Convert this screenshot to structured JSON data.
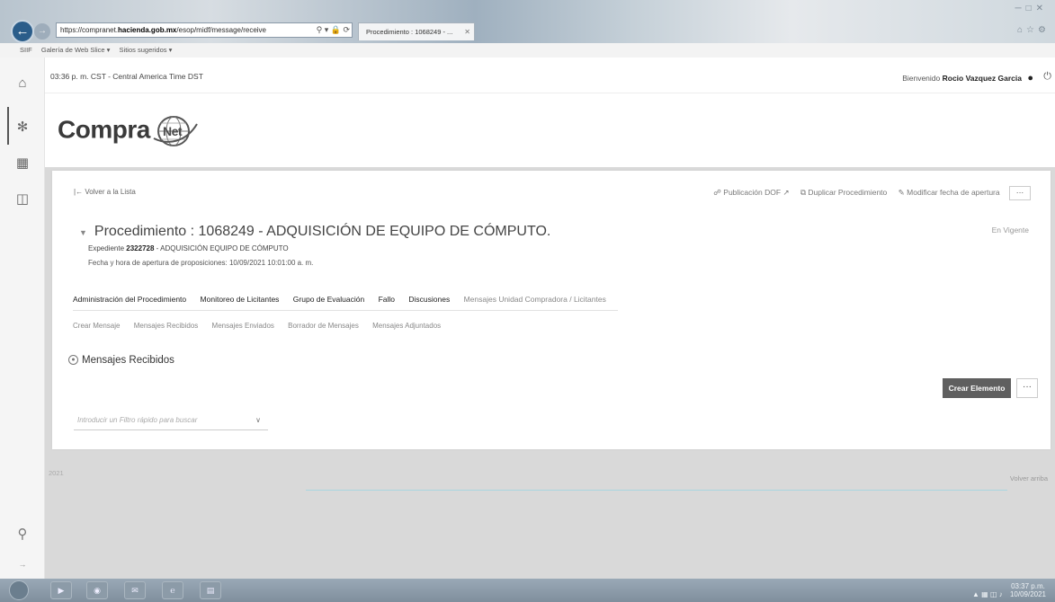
{
  "browser": {
    "url_prefix": "https://compranet.",
    "url_domain": "hacienda.gob.mx",
    "url_rest": "/esop/midf/message/receive",
    "tab_title": "Procedimiento : 1068249 - ...",
    "favorites": [
      "SIIF",
      "Galería de Web Slice ▾",
      "Sitios sugeridos ▾"
    ]
  },
  "header": {
    "time": "03:36 p. m. CST - Central America Time DST",
    "welcome_label": "Bienvenido",
    "user_name": "Rocio Vazquez Garcia"
  },
  "logo": {
    "text": "Compra",
    "text_globe": "Net"
  },
  "page": {
    "back_link": "Volver a la Lista",
    "actions": [
      "Publicación DOF",
      "Duplicar Procedimiento",
      "Modificar fecha de apertura"
    ],
    "more_label": "···",
    "title": "Procedimiento : 1068249 - ADQUISICIÓN DE EQUIPO DE CÓMPUTO.",
    "status": "En Vigente",
    "expediente_label": "Expediente",
    "expediente_number": "2322728",
    "expediente_desc": "- ADQUISICIÓN EQUIPO DE CÓMPUTO",
    "fecha": "Fecha y hora de apertura de proposiciones: 10/09/2021 10:01:00 a. m.",
    "main_tabs": [
      "Administración del Procedimiento",
      "Monitoreo de Licitantes",
      "Grupo de Evaluación",
      "Fallo",
      "Discusiones",
      "Mensajes Unidad Compradora / Licitantes"
    ],
    "sub_tabs": [
      "Crear Mensaje",
      "Mensajes Recibidos",
      "Mensajes Enviados",
      "Borrador de Mensajes",
      "Mensajes Adjuntados"
    ],
    "section_title": "Mensajes Recibidos",
    "create_button": "Crear Elemento",
    "filter_placeholder": "Introducir un Filtro rápido para buscar"
  },
  "footer": {
    "year": "2021",
    "back_to_top": "Volver arriba"
  },
  "taskbar": {
    "time": "03:37 p.m.",
    "date": "10/09/2021"
  }
}
